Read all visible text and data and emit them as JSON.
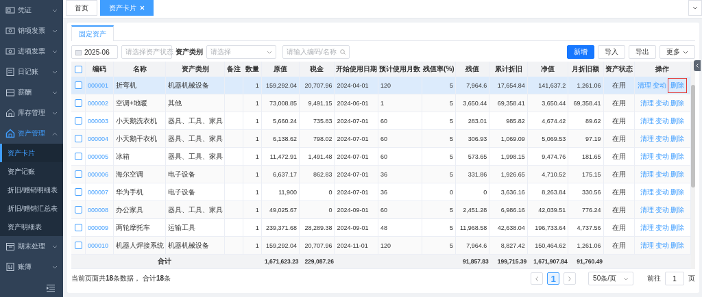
{
  "sidebar": {
    "items": [
      {
        "label": "凭证",
        "expanded": false,
        "selected": false
      },
      {
        "label": "销项发票",
        "expanded": false,
        "selected": false
      },
      {
        "label": "进项发票",
        "expanded": false,
        "selected": false
      },
      {
        "label": "日记账",
        "expanded": false,
        "selected": false
      },
      {
        "label": "薪酬",
        "expanded": false,
        "selected": false
      },
      {
        "label": "库存管理",
        "expanded": false,
        "selected": false
      },
      {
        "label": "资产管理",
        "expanded": true,
        "selected": true,
        "children": [
          {
            "label": "资产卡片",
            "selected": true
          },
          {
            "label": "资产记账",
            "selected": false
          },
          {
            "label": "折旧/赠销明细表",
            "selected": false
          },
          {
            "label": "折旧/赠销汇总表",
            "selected": false
          },
          {
            "label": "资产明细表",
            "selected": false
          }
        ]
      },
      {
        "label": "期末处理",
        "expanded": false,
        "selected": false
      },
      {
        "label": "账簿",
        "expanded": false,
        "selected": false
      }
    ]
  },
  "tabs": [
    {
      "label": "首页",
      "selected": false,
      "closable": false
    },
    {
      "label": "资产卡片",
      "selected": true,
      "closable": true
    }
  ],
  "sub_tabs": [
    {
      "label": "固定资产",
      "selected": true
    }
  ],
  "filters": {
    "period": "2025-06",
    "status": {
      "placeholder": "请选择资产状态"
    },
    "category": {
      "label": "资产类别",
      "placeholder": "请选择"
    },
    "search": {
      "placeholder": "请输入编码/名称"
    }
  },
  "actions": [
    {
      "label": "新增",
      "kind": "primary"
    },
    {
      "label": "导入",
      "kind": "default"
    },
    {
      "label": "导出",
      "kind": "default"
    },
    {
      "label": "更多",
      "kind": "dropdown"
    }
  ],
  "table": {
    "header_checked": false,
    "columns": [
      "编码",
      "名称",
      "资产类别",
      "备注",
      "数量",
      "原值",
      "税金",
      "开始使用日期",
      "预计使用月数",
      "残值率(%)",
      "残值",
      "累计折旧",
      "净值",
      "月折旧额",
      "资产状态",
      "操作"
    ],
    "rows": [
      {
        "selected": true,
        "checked": false,
        "code": "000001",
        "name": "折弯机",
        "category": "机器机械设备",
        "quantity": "1",
        "original_value": "159,292.04",
        "tax": "20,707.96",
        "start_date": "2024-04-01",
        "months": "120",
        "residual_rate": "5",
        "residual_value": "7,964.6",
        "accumulated_depreciation": "17,654.84",
        "net_value": "141,637.2",
        "monthly_depreciation": "1,261.06",
        "status": "在用",
        "actions": [
          {
            "label": "清理",
            "highlighted": false
          },
          {
            "label": "变动",
            "highlighted": false
          },
          {
            "label": "删除",
            "highlighted": true
          }
        ]
      },
      {
        "selected": false,
        "checked": false,
        "code": "000002",
        "name": "空调+地暖",
        "category": "其他",
        "quantity": "1",
        "original_value": "73,008.85",
        "tax": "9,491.15",
        "start_date": "2024-06-01",
        "months": "1",
        "residual_rate": "5",
        "residual_value": "3,650.44",
        "accumulated_depreciation": "69,358.41",
        "net_value": "3,650.44",
        "monthly_depreciation": "69,358.41",
        "status": "在用",
        "actions": [
          {
            "label": "清理",
            "highlighted": false
          },
          {
            "label": "变动",
            "highlighted": false
          },
          {
            "label": "删除",
            "highlighted": false
          }
        ]
      },
      {
        "selected": false,
        "checked": false,
        "code": "000003",
        "name": "小天鹅洗衣机",
        "category": "器具、工具、家具",
        "quantity": "1",
        "original_value": "5,660.24",
        "tax": "735.83",
        "start_date": "2024-07-01",
        "months": "60",
        "residual_rate": "5",
        "residual_value": "283.01",
        "accumulated_depreciation": "985.82",
        "net_value": "4,674.42",
        "monthly_depreciation": "89.62",
        "status": "在用",
        "actions": [
          {
            "label": "清理",
            "highlighted": false
          },
          {
            "label": "变动",
            "highlighted": false
          },
          {
            "label": "删除",
            "highlighted": false
          }
        ]
      },
      {
        "selected": false,
        "checked": false,
        "code": "000004",
        "name": "小天鹅干衣机",
        "category": "器具、工具、家具",
        "quantity": "1",
        "original_value": "6,138.62",
        "tax": "798.02",
        "start_date": "2024-07-01",
        "months": "60",
        "residual_rate": "5",
        "residual_value": "306.93",
        "accumulated_depreciation": "1,069.09",
        "net_value": "5,069.53",
        "monthly_depreciation": "97.19",
        "status": "在用",
        "actions": [
          {
            "label": "清理",
            "highlighted": false
          },
          {
            "label": "变动",
            "highlighted": false
          },
          {
            "label": "删除",
            "highlighted": false
          }
        ]
      },
      {
        "selected": false,
        "checked": false,
        "code": "000005",
        "name": "冰箱",
        "category": "器具、工具、家具",
        "quantity": "1",
        "original_value": "11,472.91",
        "tax": "1,491.48",
        "start_date": "2024-07-01",
        "months": "60",
        "residual_rate": "5",
        "residual_value": "573.65",
        "accumulated_depreciation": "1,998.15",
        "net_value": "9,474.76",
        "monthly_depreciation": "181.65",
        "status": "在用",
        "actions": [
          {
            "label": "清理",
            "highlighted": false
          },
          {
            "label": "变动",
            "highlighted": false
          },
          {
            "label": "删除",
            "highlighted": false
          }
        ]
      },
      {
        "selected": false,
        "checked": false,
        "code": "000006",
        "name": "海尔空调",
        "category": "电子设备",
        "quantity": "1",
        "original_value": "6,637.17",
        "tax": "862.83",
        "start_date": "2024-07-01",
        "months": "36",
        "residual_rate": "5",
        "residual_value": "331.86",
        "accumulated_depreciation": "1,926.65",
        "net_value": "4,710.52",
        "monthly_depreciation": "175.15",
        "status": "在用",
        "actions": [
          {
            "label": "清理",
            "highlighted": false
          },
          {
            "label": "变动",
            "highlighted": false
          },
          {
            "label": "删除",
            "highlighted": false
          }
        ]
      },
      {
        "selected": false,
        "checked": false,
        "code": "000007",
        "name": "华为手机",
        "category": "电子设备",
        "quantity": "1",
        "original_value": "11,900",
        "tax": "0",
        "start_date": "2024-07-01",
        "months": "36",
        "residual_rate": "0",
        "residual_value": "0",
        "accumulated_depreciation": "3,636.16",
        "net_value": "8,263.84",
        "monthly_depreciation": "330.56",
        "status": "在用",
        "actions": [
          {
            "label": "清理",
            "highlighted": false
          },
          {
            "label": "变动",
            "highlighted": false
          },
          {
            "label": "删除",
            "highlighted": false
          }
        ]
      },
      {
        "selected": false,
        "checked": false,
        "code": "000008",
        "name": "办公家具",
        "category": "器具、工具、家具",
        "quantity": "1",
        "original_value": "49,025.67",
        "tax": "0",
        "start_date": "2024-09-01",
        "months": "60",
        "residual_rate": "5",
        "residual_value": "2,451.28",
        "accumulated_depreciation": "6,986.16",
        "net_value": "42,039.51",
        "monthly_depreciation": "776.24",
        "status": "在用",
        "actions": [
          {
            "label": "清理",
            "highlighted": false
          },
          {
            "label": "变动",
            "highlighted": false
          },
          {
            "label": "删除",
            "highlighted": false
          }
        ]
      },
      {
        "selected": false,
        "checked": false,
        "code": "000009",
        "name": "两轮摩托车",
        "category": "运输工具",
        "quantity": "1",
        "original_value": "239,371.68",
        "tax": "28,289.38",
        "start_date": "2024-09-01",
        "months": "48",
        "residual_rate": "5",
        "residual_value": "11,968.58",
        "accumulated_depreciation": "42,638.04",
        "net_value": "196,733.64",
        "monthly_depreciation": "4,737.56",
        "status": "在用",
        "actions": [
          {
            "label": "清理",
            "highlighted": false
          },
          {
            "label": "变动",
            "highlighted": false
          },
          {
            "label": "删除",
            "highlighted": false
          }
        ]
      },
      {
        "selected": false,
        "checked": false,
        "code": "000010",
        "name": "机器人焊接系统",
        "category": "机器机械设备",
        "quantity": "1",
        "original_value": "159,292.04",
        "tax": "20,707.96",
        "start_date": "2024-11-01",
        "months": "120",
        "residual_rate": "5",
        "residual_value": "7,964.6",
        "accumulated_depreciation": "8,827.42",
        "net_value": "150,464.62",
        "monthly_depreciation": "1,261.06",
        "status": "在用",
        "actions": [
          {
            "label": "清理",
            "highlighted": false
          },
          {
            "label": "变动",
            "highlighted": false
          },
          {
            "label": "删除",
            "highlighted": false
          }
        ]
      }
    ],
    "summary": {
      "label": "合计",
      "original_value": "1,671,623.23",
      "tax": "229,087.26",
      "residual_value": "91,857.83",
      "accumulated_depreciation": "199,715.39",
      "net_value": "1,671,907.84",
      "monthly_depreciation": "91,760.49"
    }
  },
  "pagination": {
    "info": "当前页面共**18**条数据， 合计**18**条",
    "pages": [
      {
        "label": "1",
        "selected": true
      }
    ],
    "page_size": "50条/页",
    "goto": {
      "label": "前往",
      "value": "1",
      "suffix": "页"
    }
  }
}
